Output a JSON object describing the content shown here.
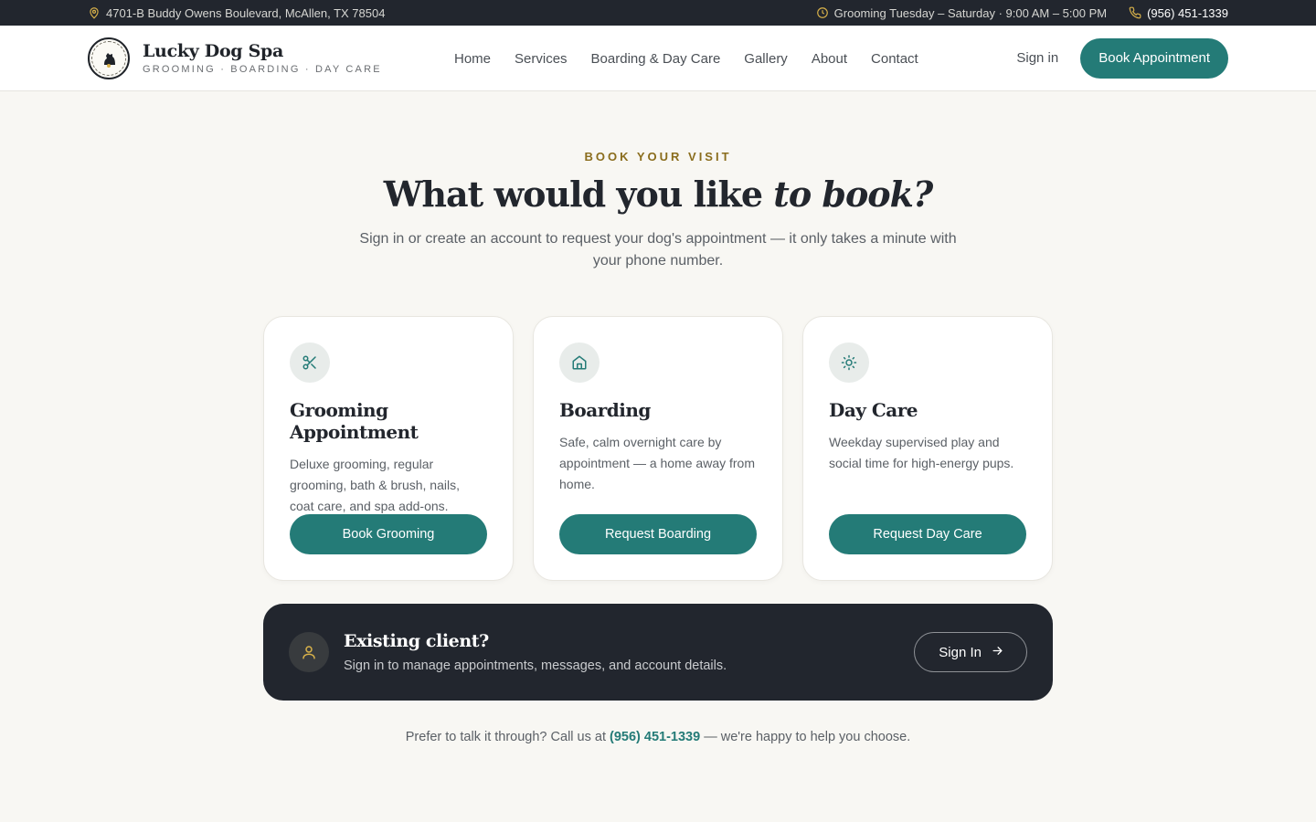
{
  "topbar": {
    "address": "4701-B Buddy Owens Boulevard, McAllen, TX 78504",
    "hours": "Grooming Tuesday – Saturday · 9:00 AM – 5:00 PM",
    "phone": "(956) 451-1339"
  },
  "brand": {
    "name": "Lucky Dog Spa",
    "tagline": "GROOMING · BOARDING · DAY CARE"
  },
  "nav": {
    "items": [
      "Home",
      "Services",
      "Boarding & Day Care",
      "Gallery",
      "About",
      "Contact"
    ],
    "signin": "Sign in",
    "cta": "Book Appointment"
  },
  "hero": {
    "eyebrow": "BOOK YOUR VISIT",
    "title_plain": "What would you like ",
    "title_italic": "to book?",
    "subtitle": "Sign in or create an account to request your dog's appointment — it only takes a minute with your phone number."
  },
  "cards": [
    {
      "icon": "scissors-icon",
      "title": "Grooming Appointment",
      "description": "Deluxe grooming, regular grooming, bath & brush, nails, coat care, and spa add-ons.",
      "button": "Book Grooming"
    },
    {
      "icon": "house-icon",
      "title": "Boarding",
      "description": "Safe, calm overnight care by appointment — a home away from home.",
      "button": "Request Boarding"
    },
    {
      "icon": "sun-icon",
      "title": "Day Care",
      "description": "Weekday supervised play and social time for high-energy pups.",
      "button": "Request Day Care"
    }
  ],
  "existing_client": {
    "title": "Existing client?",
    "subtitle": "Sign in to manage appointments, messages, and account details.",
    "button": "Sign In"
  },
  "footer_note": {
    "before": "Prefer to talk it through? Call us at ",
    "phone": "(956) 451-1339",
    "after": " — we're happy to help you choose."
  },
  "colors": {
    "accent": "#247b77",
    "dark": "#22262e",
    "gold": "#8a6d1d",
    "background": "#f8f7f3"
  }
}
